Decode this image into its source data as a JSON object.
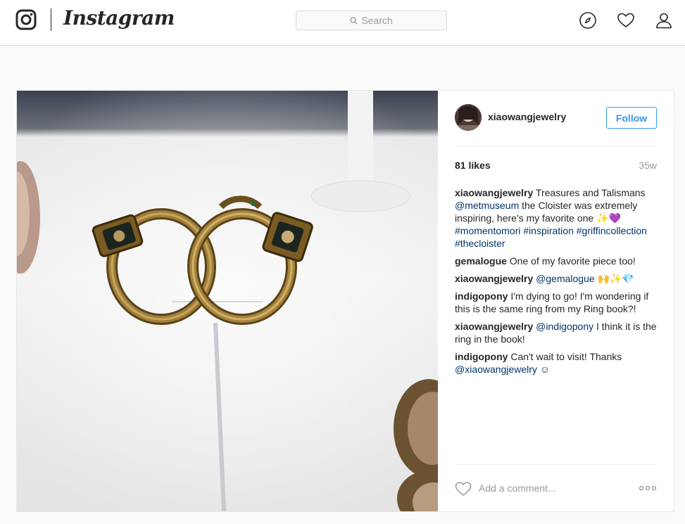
{
  "brand": {
    "wordmark": "Instagram"
  },
  "search": {
    "placeholder": "Search"
  },
  "nav": {
    "icons": [
      "explore-icon",
      "heart-icon",
      "profile-icon"
    ]
  },
  "post": {
    "username": "xiaowangjewelry",
    "follow_label": "Follow",
    "likes": "81 likes",
    "age": "35w",
    "comments": [
      {
        "user": "xiaowangjewelry",
        "parts": [
          {
            "t": "Treasures and Talismans "
          },
          {
            "t": "@metmuseum",
            "link": true
          },
          {
            "t": " the Cloister was extremely inspiring, here's my favorite one ✨💜 "
          },
          {
            "t": "#momentomori",
            "link": true
          },
          {
            "t": " "
          },
          {
            "t": "#inspiration",
            "link": true
          },
          {
            "t": " "
          },
          {
            "t": "#griffincollection",
            "link": true
          },
          {
            "t": " "
          },
          {
            "t": "#thecloister",
            "link": true
          }
        ]
      },
      {
        "user": "gemalogue",
        "parts": [
          {
            "t": "One of my favorite piece too!"
          }
        ]
      },
      {
        "user": "xiaowangjewelry",
        "parts": [
          {
            "t": "@gemalogue",
            "link": true
          },
          {
            "t": " 🙌✨💎"
          }
        ]
      },
      {
        "user": "indigopony",
        "parts": [
          {
            "t": "I'm dying to go! I'm wondering if this is the same ring from my Ring book?!"
          }
        ]
      },
      {
        "user": "xiaowangjewelry",
        "parts": [
          {
            "t": "@indigopony",
            "link": true
          },
          {
            "t": " I think it is the ring in the book!"
          }
        ]
      },
      {
        "user": "indigopony",
        "parts": [
          {
            "t": "Can't wait to visit! Thanks "
          },
          {
            "t": "@xiaowangjewelry",
            "link": true
          },
          {
            "t": " ☺"
          }
        ]
      }
    ],
    "add_comment_placeholder": "Add a comment...",
    "more_icon": "more-options-icon"
  },
  "colors": {
    "accent": "#3897f0",
    "link": "#003569",
    "muted": "#999999",
    "border": "#dbdbdb"
  }
}
